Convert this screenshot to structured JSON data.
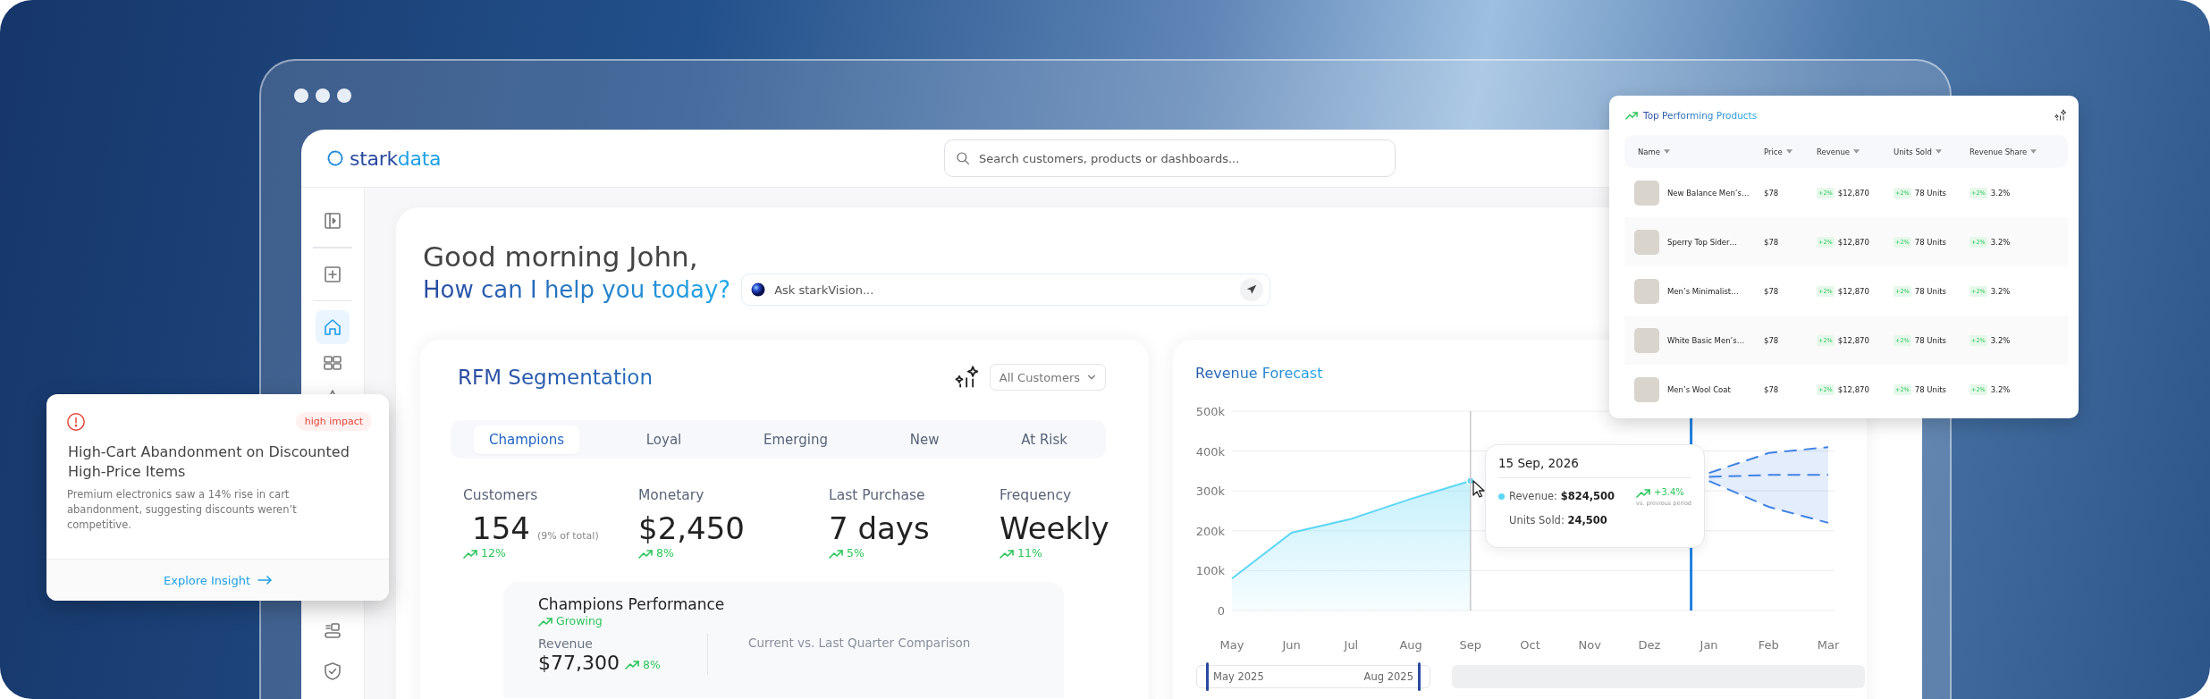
{
  "header": {
    "logo_parts": [
      "stark",
      "data"
    ],
    "search": {
      "placeholder": "Search customers, products or dashboards..."
    }
  },
  "sidebar": {
    "top_items": [
      {
        "kind": "panel",
        "selected": false
      },
      {
        "kind": "add",
        "selected": false
      }
    ],
    "nav_items": [
      {
        "kind": "home",
        "selected": true
      },
      {
        "kind": "grid",
        "selected": false
      },
      {
        "kind": "star",
        "selected": false
      }
    ],
    "bottom_items": [
      {
        "kind": "tasks",
        "selected": false
      },
      {
        "kind": "shield",
        "selected": false
      }
    ]
  },
  "greeting": {
    "title": "Good morning John,",
    "subtitle": "How can I help you today?",
    "ask": {
      "placeholder": "Ask starkVision..."
    }
  },
  "rfm": {
    "title": "RFM Segmentation",
    "filter": "All Customers",
    "tabs": [
      {
        "label": "Champions",
        "selected": true
      },
      {
        "label": "Loyal",
        "selected": false
      },
      {
        "label": "Emerging",
        "selected": false
      },
      {
        "label": "New",
        "selected": false
      },
      {
        "label": "At Risk",
        "selected": false
      }
    ],
    "metrics": [
      {
        "label": "Customers",
        "value": "154",
        "note": "(9% of total)",
        "trend": "12%"
      },
      {
        "label": "Monetary",
        "value": "$2,450",
        "trend": "8%"
      },
      {
        "label": "Last Purchase",
        "value": "7 days",
        "trend": "5%"
      },
      {
        "label": "Frequency",
        "value": "Weekly",
        "trend": "11%"
      }
    ],
    "performance": {
      "title": "Champions Performance",
      "status": "Growing",
      "metric_label": "Revenue",
      "metric_value": "$77,300",
      "metric_trend": "8%",
      "comparison_title": "Current vs. Last Quarter Comparison"
    }
  },
  "forecast": {
    "title": "Revenue Forecast",
    "chart_data": {
      "type": "line",
      "categories": [
        "May",
        "Jun",
        "Jul",
        "Aug",
        "Sep",
        "Oct",
        "Nov",
        "Dez",
        "Jan",
        "Feb",
        "Mar"
      ],
      "ylim": [
        0,
        500000
      ],
      "grid": true,
      "yticks": [
        {
          "value": 0,
          "label": "0"
        },
        {
          "value": 100000,
          "label": "100k"
        },
        {
          "value": 200000,
          "label": "200k"
        },
        {
          "value": 300000,
          "label": "300k"
        },
        {
          "value": 400000,
          "label": "400k"
        },
        {
          "value": 500000,
          "label": "500k"
        }
      ],
      "series": [
        {
          "color": "#5cd6f6",
          "line_style": "solid",
          "values": [
            80000,
            195000,
            230000,
            280000,
            325000,
            null,
            null,
            null,
            null,
            null,
            null
          ]
        },
        {
          "color": "#3f83e6",
          "line_style": "dashed",
          "values": [
            null,
            null,
            null,
            null,
            null,
            null,
            null,
            null,
            345000,
            395000,
            410000
          ]
        },
        {
          "color": "#3f83e6",
          "line_style": "dashed",
          "values": [
            null,
            null,
            null,
            null,
            null,
            null,
            null,
            null,
            335000,
            340000,
            340000
          ]
        },
        {
          "color": "#3f83e6",
          "line_style": "dashed",
          "values": [
            null,
            null,
            null,
            null,
            null,
            null,
            null,
            null,
            325000,
            260000,
            220000
          ]
        }
      ]
    },
    "tooltip": {
      "date": "15 Sep, 2026",
      "revenue": "Revenue: **$824,500**",
      "change": "+3.4%",
      "change_note": "vs. previous period",
      "units": "Units Sold: **24,500**"
    },
    "range": {
      "start": "May 2025",
      "end": "Aug 2025"
    }
  },
  "insight": {
    "badge": "high impact",
    "title": "High-Cart Abandonment on Discounted High-Price Items",
    "description": "Premium electronics saw a 14% rise in cart abandonment, suggesting discounts weren’t competitive.",
    "link": "Explore Insight"
  },
  "products": {
    "title": "Top Performing Products",
    "columns": [
      "Name",
      "Price",
      "Revenue",
      "Units Sold",
      "Revenue Share"
    ],
    "rows": [
      {
        "name": "New Balance Men’s…",
        "price": "$78",
        "revenue_change": "+2%",
        "revenue": "$12,870",
        "units_change": "+2%",
        "units": "78 Units",
        "share_change": "+2%",
        "share": "3.2%"
      },
      {
        "name": "Sperry Top Sider…",
        "price": "$78",
        "revenue_change": "+2%",
        "revenue": "$12,870",
        "units_change": "+2%",
        "units": "78 Units",
        "share_change": "+2%",
        "share": "3.2%"
      },
      {
        "name": "Men’s Minimalist…",
        "price": "$78",
        "revenue_change": "+2%",
        "revenue": "$12,870",
        "units_change": "+2%",
        "units": "78 Units",
        "share_change": "+2%",
        "share": "3.2%"
      },
      {
        "name": "White Basic Men’s…",
        "price": "$78",
        "revenue_change": "+2%",
        "revenue": "$12,870",
        "units_change": "+2%",
        "units": "78 Units",
        "share_change": "+2%",
        "share": "3.2%"
      },
      {
        "name": "Men’s Wool Coat",
        "price": "$78",
        "revenue_change": "+2%",
        "revenue": "$12,870",
        "units_change": "+2%",
        "units": "78 Units",
        "share_change": "+2%",
        "share": "3.2%"
      }
    ]
  }
}
